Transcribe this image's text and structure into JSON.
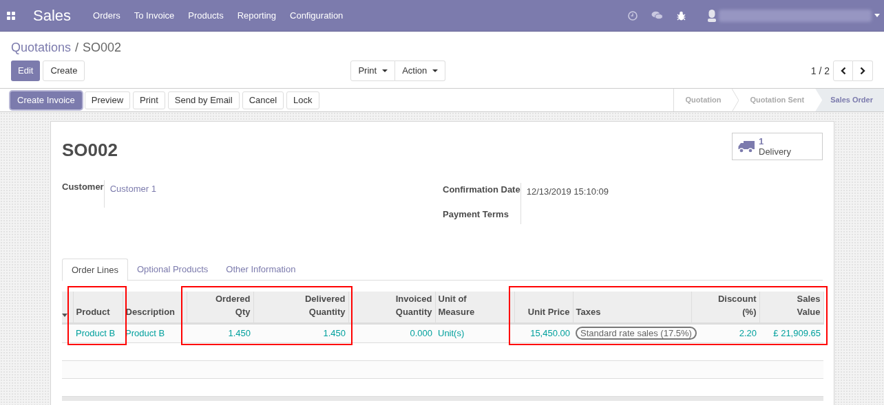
{
  "navbar": {
    "app": "Sales",
    "menu": [
      "Orders",
      "To Invoice",
      "Products",
      "Reporting",
      "Configuration"
    ]
  },
  "breadcrumbs": [
    {
      "label": "Quotations",
      "link": true,
      "separator": "/"
    },
    {
      "label": "SO002",
      "link": false
    }
  ],
  "buttons": [
    {
      "label": "Edit",
      "primary": true
    },
    {
      "label": "Create",
      "primary": false
    }
  ],
  "dropdowns": [
    "Print",
    "Action"
  ],
  "pager": "1 / 2",
  "actions": [
    {
      "label": "Create Invoice",
      "primary": true
    },
    {
      "label": "Preview",
      "primary": false
    },
    {
      "label": "Print",
      "primary": false
    },
    {
      "label": "Send by Email",
      "primary": false
    },
    {
      "label": "Cancel",
      "primary": false
    },
    {
      "label": "Lock",
      "primary": false
    }
  ],
  "stages": [
    {
      "label": "Quotation",
      "selected": false
    },
    {
      "label": "Quotation Sent",
      "selected": false
    },
    {
      "label": "Sales Order",
      "selected": true
    }
  ],
  "record": {
    "name": "SO002",
    "smart_button": {
      "count": "1",
      "label": "Delivery"
    },
    "fields_left": [
      {
        "label": "Customer",
        "value": "Customer 1",
        "link": true
      }
    ],
    "fields_right": [
      {
        "label": "Confirmation Date",
        "value": "12/13/2019 15:10:09"
      },
      {
        "label": "Payment Terms"
      }
    ]
  },
  "tabs": [
    {
      "label": "Order Lines",
      "selected": true
    },
    {
      "label": "Optional Products",
      "selected": false
    },
    {
      "label": "Other Information",
      "selected": false
    }
  ],
  "table": {
    "columns": [
      {
        "label": "Product",
        "outlined": true
      },
      {
        "label": "Description",
        "outlined": false
      },
      {
        "label": "Ordered Qty",
        "outlined": true
      },
      {
        "label": "Delivered Quantity",
        "outlined": true
      },
      {
        "label": "Invoiced Quantity",
        "outlined": false
      },
      {
        "label": "Unit of Measure",
        "outlined": false
      },
      {
        "label": "Unit Price",
        "outlined": true
      },
      {
        "label": "Taxes",
        "outlined": true
      },
      {
        "label": "Discount (%)",
        "outlined": true
      },
      {
        "label": "Sales Value",
        "outlined": true
      }
    ],
    "rows": [
      {
        "cells": [
          {
            "text": "Product B",
            "kind": "link"
          },
          {
            "text": "Product B",
            "kind": "link"
          },
          {
            "text": "1.450",
            "kind": "link"
          },
          {
            "text": "1.450",
            "kind": "link"
          },
          {
            "text": "0.000",
            "kind": "link"
          },
          {
            "text": "Unit(s)",
            "kind": "link"
          },
          {
            "text": "15,450.00",
            "kind": "link"
          },
          {
            "text": "Standard rate sales (17.5%)",
            "kind": "tag"
          },
          {
            "text": "2.20",
            "kind": "link"
          },
          {
            "text": "£ 21,909.65",
            "kind": "link"
          }
        ]
      }
    ]
  }
}
